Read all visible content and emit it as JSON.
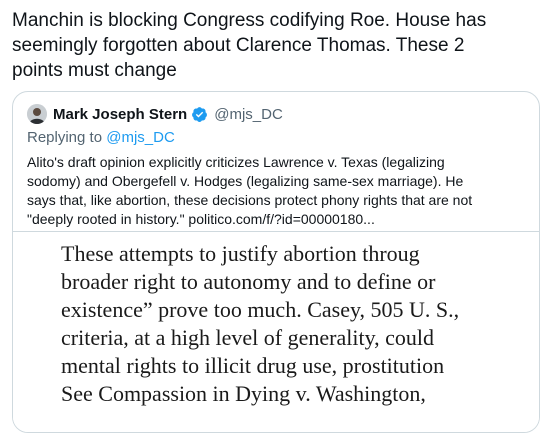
{
  "tweet": {
    "lines": [
      "Manchin is blocking Congress codifying Roe. House has",
      "seemingly forgotten about Clarence Thomas. These 2",
      "points must change"
    ]
  },
  "quote": {
    "author_name": "Mark Joseph Stern",
    "verified_icon": "verified-badge-icon",
    "handle": "@mjs_DC",
    "replying_prefix": "Replying to",
    "replying_handle": "@mjs_DC",
    "body_lines": [
      "Alito's draft opinion explicitly criticizes Lawrence v. Texas (legalizing",
      "sodomy) and Obergefell v. Hodges (legalizing same-sex marriage). He",
      "says that, like abortion, these decisions protect phony rights that are not",
      "\"deeply rooted in history.\" politico.com/f/?id=00000180..."
    ],
    "image_lines": [
      "These attempts to justify abortion throug",
      "broader right to autonomy and to define or",
      "existence” prove too much.  Casey, 505 U. S.,",
      "criteria, at a high level of generality, could",
      "mental rights to illicit drug use, prostitution",
      "See Compassion in Dying v. Washington,"
    ]
  },
  "colors": {
    "text": "#0f1419",
    "secondary": "#536471",
    "link": "#1d9bf0",
    "border": "#cfd9de"
  }
}
